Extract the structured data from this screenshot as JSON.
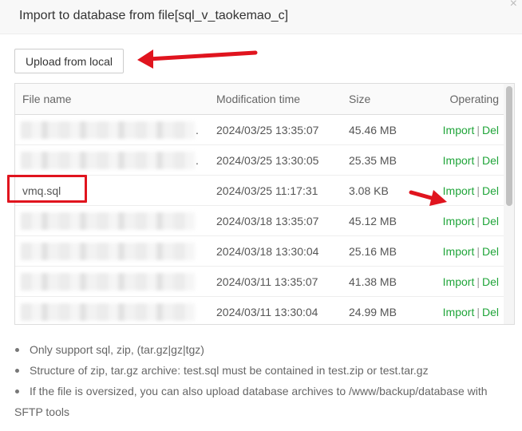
{
  "dialog": {
    "title": "Import to database from file[sql_v_taokemao_c]",
    "close_glyph": "×",
    "upload_label": "Upload from local"
  },
  "table": {
    "headers": {
      "name": "File name",
      "time": "Modification time",
      "size": "Size",
      "op": "Operating"
    },
    "rows": [
      {
        "name": "",
        "name_blurred": true,
        "trailing": ".",
        "time": "2024/03/25 13:35:07",
        "size": "45.46 MB"
      },
      {
        "name": "",
        "name_blurred": true,
        "trailing": ".",
        "time": "2024/03/25 13:30:05",
        "size": "25.35 MB"
      },
      {
        "name": "vmq.sql",
        "name_blurred": false,
        "trailing": "",
        "time": "2024/03/25 11:17:31",
        "size": "3.08 KB"
      },
      {
        "name": "",
        "name_blurred": true,
        "trailing": "",
        "time": "2024/03/18 13:35:07",
        "size": "45.12 MB"
      },
      {
        "name": "",
        "name_blurred": true,
        "trailing": "",
        "time": "2024/03/18 13:30:04",
        "size": "25.16 MB"
      },
      {
        "name": "",
        "name_blurred": true,
        "trailing": "",
        "time": "2024/03/11 13:35:07",
        "size": "41.38 MB"
      },
      {
        "name": "",
        "name_blurred": true,
        "trailing": "",
        "time": "2024/03/11 13:30:04",
        "size": "24.99 MB"
      }
    ],
    "op_import": "Import",
    "op_sep": "|",
    "op_del": "Del"
  },
  "notes": [
    "Only support sql, zip, (tar.gz|gz|tgz)",
    "Structure of zip, tar.gz archive: test.sql must be contained in test.zip or test.tar.gz",
    "If the file is oversized, you can also upload database archives to /www/backup/database with"
  ],
  "notes_continuation": "SFTP tools",
  "colors": {
    "accent_green": "#20a53a",
    "annotation_red": "#e0141e"
  }
}
